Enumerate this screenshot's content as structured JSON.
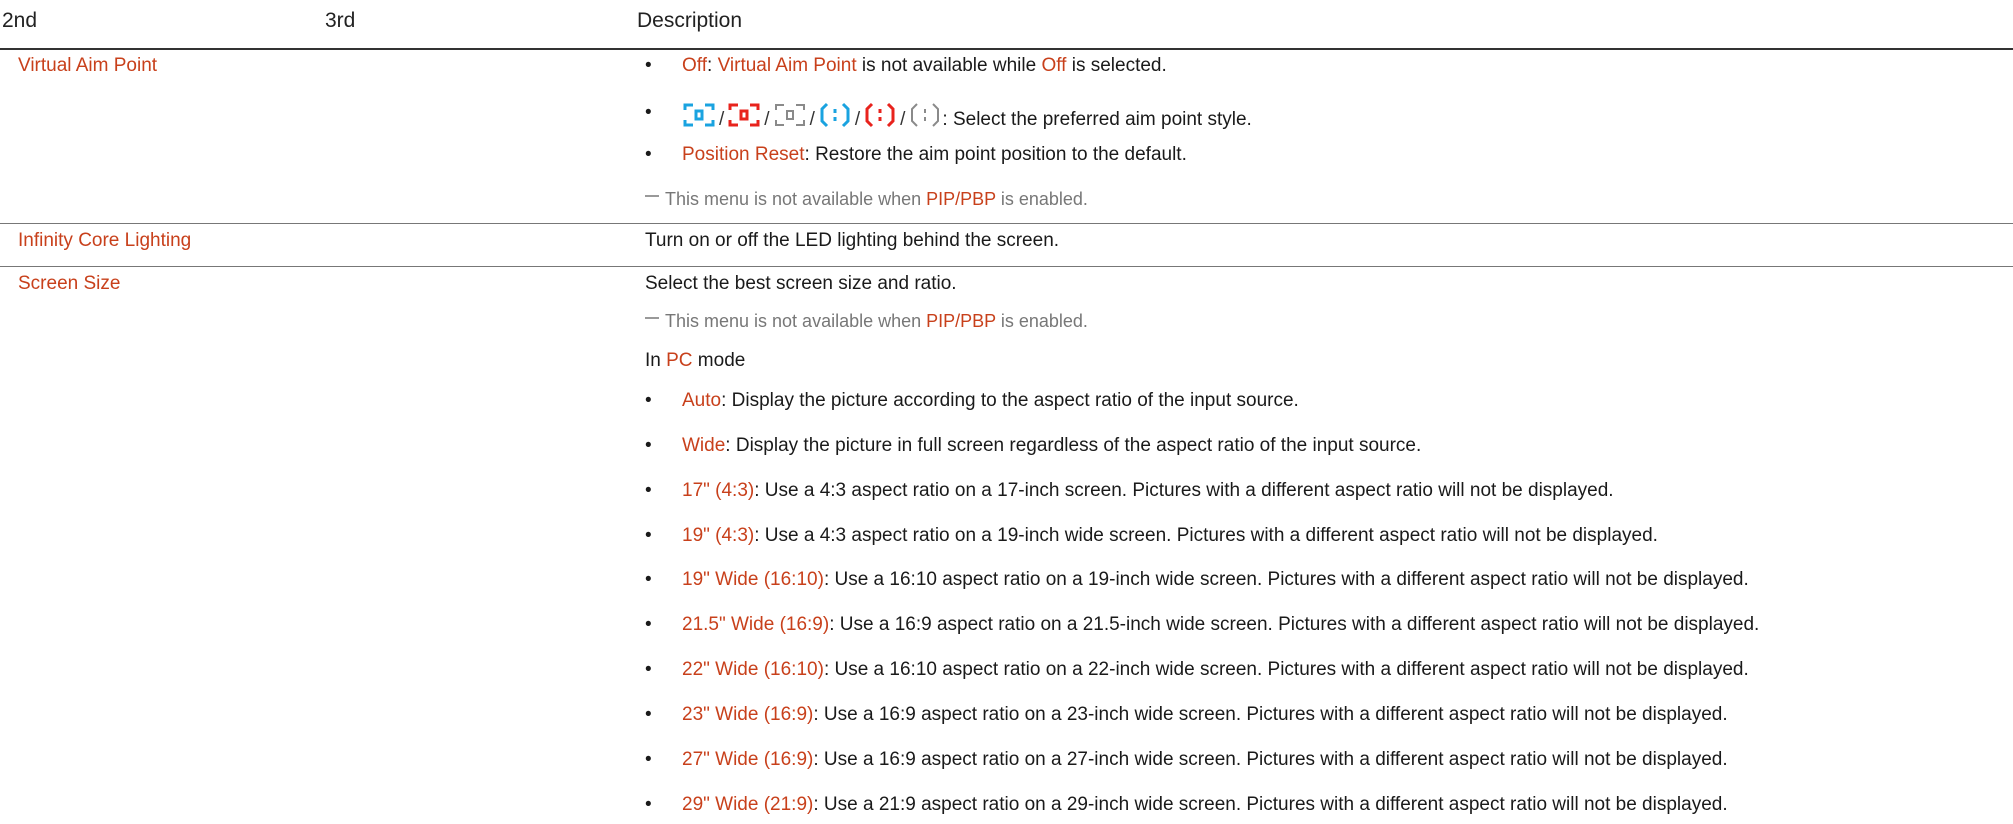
{
  "header": {
    "col2": "2nd",
    "col3": "3rd",
    "col4": "Description"
  },
  "colors": {
    "highlight": "#c8401b",
    "aim_blue": "#1aa3e0",
    "aim_red": "#e8231d",
    "aim_gray": "#8a8a8a"
  },
  "virtual_aim_point": {
    "name": "Virtual Aim Point",
    "off": {
      "term": "Off",
      "sep": ": ",
      "term2": "Virtual Aim Point",
      "mid": " is not available while ",
      "term3": "Off",
      "end": " is selected."
    },
    "styles": {
      "icons": [
        "aim-style-1-icon",
        "aim-style-2-icon",
        "aim-style-3-icon",
        "aim-style-4-icon",
        "aim-style-5-icon",
        "aim-style-6-icon"
      ],
      "slash": "/",
      "text": ": Select the preferred aim point style."
    },
    "reset": {
      "term": "Position Reset",
      "text": ": Restore the aim point position to the default."
    },
    "note": {
      "pre": "This menu is not available when ",
      "term": "PIP/PBP",
      "post": " is enabled."
    }
  },
  "infinity_core": {
    "name": "Infinity Core Lighting",
    "desc": "Turn on or off the LED lighting behind the screen."
  },
  "screen_size": {
    "name": "Screen Size",
    "desc": "Select the best screen size and ratio.",
    "note": {
      "pre": "This menu is not available when ",
      "term": "PIP/PBP",
      "post": " is enabled."
    },
    "mode": {
      "pre": "In ",
      "term": "PC",
      "post": " mode"
    },
    "items": [
      {
        "term": "Auto",
        "text": ": Display the picture according to the aspect ratio of the input source."
      },
      {
        "term": "Wide",
        "text": ": Display the picture in full screen regardless of the aspect ratio of the input source."
      },
      {
        "term": "17\" (4:3)",
        "text": ": Use a 4:3 aspect ratio on a 17-inch screen. Pictures with a different aspect ratio will not be displayed."
      },
      {
        "term": "19\" (4:3)",
        "text": ": Use a 4:3 aspect ratio on a 19-inch wide screen. Pictures with a different aspect ratio will not be displayed."
      },
      {
        "term": "19\" Wide (16:10)",
        "text": ": Use a 16:10 aspect ratio on a 19-inch wide screen. Pictures with a different aspect ratio will not be displayed."
      },
      {
        "term": "21.5\" Wide (16:9)",
        "text": ": Use a 16:9 aspect ratio on a 21.5-inch wide screen. Pictures with a different aspect ratio will not be displayed."
      },
      {
        "term": "22\" Wide (16:10)",
        "text": ": Use a 16:10 aspect ratio on a 22-inch wide screen. Pictures with a different aspect ratio will not be displayed."
      },
      {
        "term": "23\" Wide (16:9)",
        "text": ": Use a 16:9 aspect ratio on a 23-inch wide screen. Pictures with a different aspect ratio will not be displayed."
      },
      {
        "term": "27\" Wide (16:9)",
        "text": ": Use a 16:9 aspect ratio on a 27-inch wide screen. Pictures with a different aspect ratio will not be displayed."
      },
      {
        "term": "29\" Wide (21:9)",
        "text": ": Use a 21:9 aspect ratio on a 29-inch wide screen. Pictures with a different aspect ratio will not be displayed."
      }
    ]
  }
}
